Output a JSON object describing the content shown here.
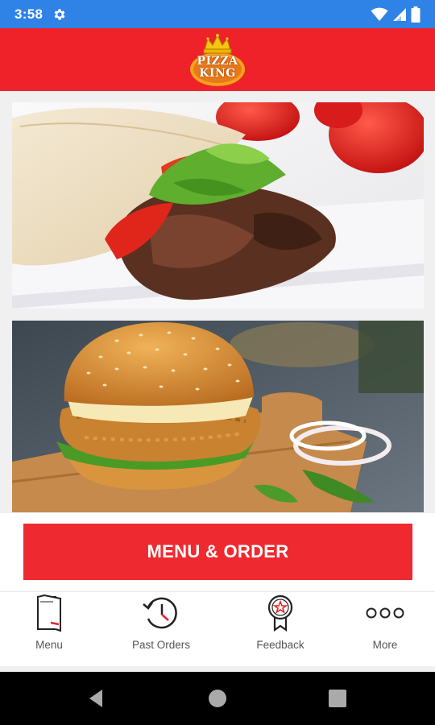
{
  "status_bar": {
    "time": "3:58",
    "icons": [
      "gear-icon",
      "wifi-icon",
      "signal-icon",
      "battery-icon"
    ]
  },
  "header": {
    "logo_line_1": "PIZZA",
    "logo_line_2": "KING",
    "logo_icon": "crown-icon"
  },
  "content": {
    "images": [
      "kebab-wrap-image",
      "chicken-burger-image"
    ]
  },
  "action": {
    "order_label": "MENU & ORDER"
  },
  "tabs": [
    {
      "label": "Menu",
      "icon": "menu-book-icon"
    },
    {
      "label": "Past Orders",
      "icon": "history-clock-icon"
    },
    {
      "label": "Feedback",
      "icon": "award-badge-icon"
    },
    {
      "label": "More",
      "icon": "more-dots-icon"
    }
  ],
  "nav_bar": {
    "icons": [
      "back-icon",
      "home-icon",
      "recents-icon"
    ]
  },
  "colors": {
    "status_bar": "#2f82e6",
    "brand_red": "#ee2228",
    "button_red": "#ee2a30"
  }
}
